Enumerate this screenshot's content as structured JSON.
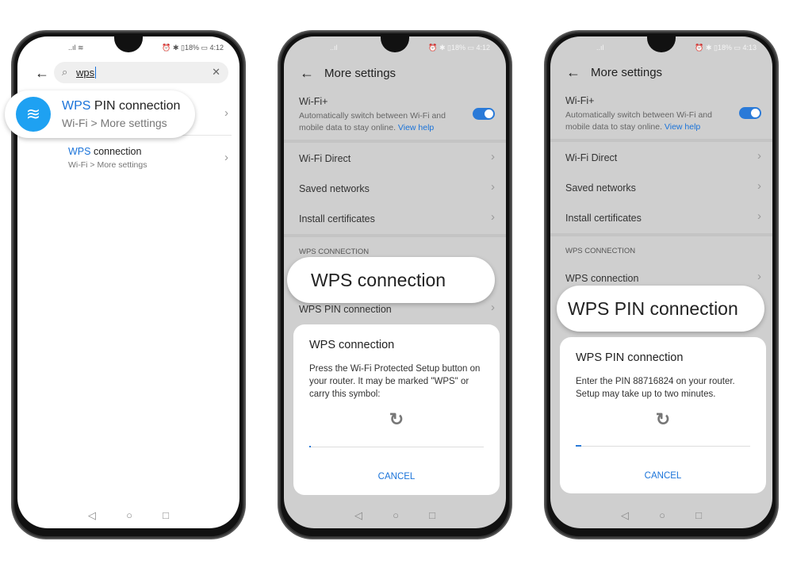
{
  "phone1": {
    "status": {
      "left": "..ıl ≋",
      "right": "⏰ ✱ ▯18% ▭ 4:12"
    },
    "search": {
      "value": "wps"
    },
    "results": [
      {
        "highlight": "WPS",
        "title": " PIN connection",
        "path": "Wi-Fi > More settings"
      },
      {
        "highlight": "WPS",
        "title": " connection",
        "path": "Wi-Fi > More settings"
      }
    ]
  },
  "phone2": {
    "status": {
      "left": "..ıl",
      "right": "⏰ ✱ ▯18% ▭ 4:12"
    },
    "title": "More settings",
    "wifiplus": {
      "label": "Wi-Fi+",
      "desc": "Automatically switch between Wi-Fi and mobile data to stay online.",
      "link": "View help",
      "enabled": true
    },
    "rows": [
      "Wi-Fi Direct",
      "Saved networks",
      "Install certificates"
    ],
    "section": "WPS CONNECTION",
    "wps_rows": [
      "WPS connection",
      "WPS PIN connection"
    ],
    "callout": "WPS connection",
    "dialog": {
      "title": "WPS connection",
      "body": "Press the Wi-Fi Protected Setup button on your router. It may be marked \"WPS\" or carry this symbol:",
      "progress_percent": 1,
      "cancel": "CANCEL"
    }
  },
  "phone3": {
    "status": {
      "left": "..ıl",
      "right": "⏰ ✱ ▯18% ▭ 4:13"
    },
    "title": "More settings",
    "wifiplus": {
      "label": "Wi-Fi+",
      "desc": "Automatically switch between Wi-Fi and mobile data to stay online.",
      "link": "View help",
      "enabled": true
    },
    "rows": [
      "Wi-Fi Direct",
      "Saved networks",
      "Install certificates"
    ],
    "section": "WPS CONNECTION",
    "wps_rows": [
      "WPS connection"
    ],
    "callout": "WPS PIN connection",
    "dialog": {
      "title": "WPS PIN connection",
      "body": "Enter the PIN 88716824 on your router. Setup may take up to two minutes.",
      "progress_percent": 3,
      "cancel": "CANCEL"
    }
  },
  "nav": {
    "back": "◁",
    "home": "○",
    "recent": "□"
  },
  "colors": {
    "accent": "#1a73d9",
    "wifi_icon_bg": "#1ea1f2"
  }
}
